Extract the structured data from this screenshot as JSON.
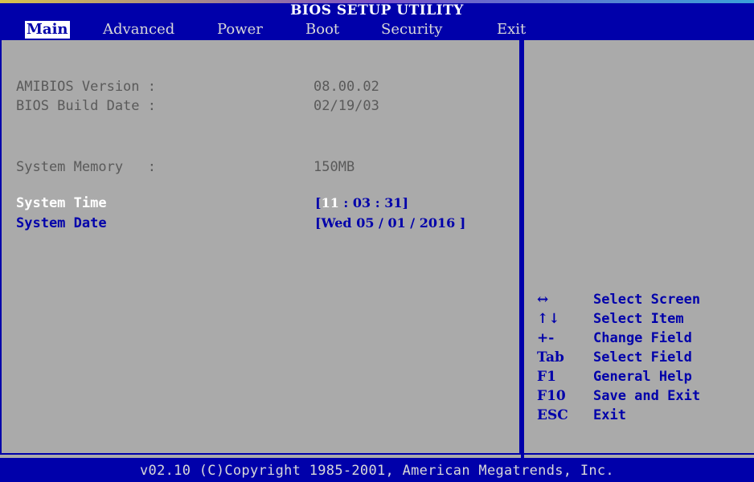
{
  "title": "BIOS SETUP UTILITY",
  "menu": [
    {
      "label": "Main",
      "active": true
    },
    {
      "label": "Advanced",
      "active": false
    },
    {
      "label": "Power",
      "active": false
    },
    {
      "label": "Boot",
      "active": false
    },
    {
      "label": "Security",
      "active": false
    },
    {
      "label": "Exit",
      "active": false
    }
  ],
  "info": {
    "amibios_label": "AMIBIOS Version :",
    "amibios_value": "08.00.02",
    "build_label": "BIOS Build Date :",
    "build_value": "02/19/03",
    "memory_label": "System Memory   :",
    "memory_value": "150MB"
  },
  "time": {
    "label": "System Time",
    "hour": "11",
    "minute": "03",
    "second": "31"
  },
  "date": {
    "label": "System Date",
    "day_name": "Wed",
    "month": "05",
    "day": "01",
    "year": "2016"
  },
  "help": [
    {
      "key": "↔",
      "desc": "Select Screen"
    },
    {
      "key": "↑↓",
      "desc": "Select Item"
    },
    {
      "key": "+-",
      "desc": "Change Field"
    },
    {
      "key": "Tab",
      "desc": "Select Field"
    },
    {
      "key": "F1",
      "desc": "General Help"
    },
    {
      "key": "F10",
      "desc": "Save and Exit"
    },
    {
      "key": "ESC",
      "desc": "Exit"
    }
  ],
  "footer": "v02.10 (C)Copyright 1985-2001, American Megatrends, Inc.",
  "colors": {
    "background": "#0000aa",
    "panel": "#aaaaaa",
    "highlight": "#ffffff",
    "static_text": "#5a5a5a"
  }
}
